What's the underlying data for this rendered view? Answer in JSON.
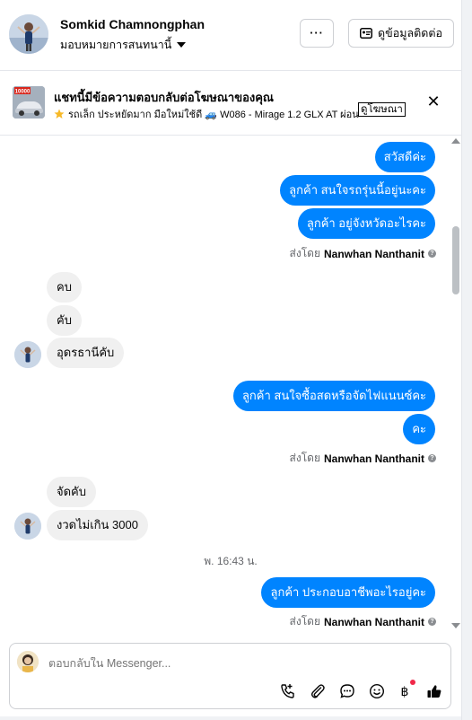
{
  "header": {
    "contact_name": "Somkid Chamnongphan",
    "assign_label": "มอบหมายการสนทนานี้",
    "more_button_label": "···",
    "contact_info_button_label": "ดูข้อมูลติดต่อ"
  },
  "ad_banner": {
    "title": "แชทนี้มีข้อความตอบกลับต่อโฆษณาของคุณ",
    "subtitle": "รถเล็ก ประหยัดมาก มือใหม่ใช้ดี 🚙 W086 - Mirage 1.2 GLX AT ผ่อน ...",
    "ad_link_label": "ดูโฆษณา",
    "thumbnail_price": "10000",
    "close_label": "✕"
  },
  "messages": {
    "m1": "สวัสดีค่ะ",
    "m2": "ลูกค้า สนใจรถรุ่นนี้อยู่นะคะ",
    "m3": "ลูกค้า อยู่จังหวัดอะไรคะ",
    "sent_by_1_prefix": "ส่งโดย",
    "sent_by_1_name": "Nanwhan Nanthanit",
    "m4": "คบ",
    "m5": "คับ",
    "m6": "อุดรธานีคับ",
    "m7": "ลูกค้า สนใจซื้อสดหรือจัดไฟแนนซ์คะ",
    "m8": "คะ",
    "sent_by_2_prefix": "ส่งโดย",
    "sent_by_2_name": "Nanwhan Nanthanit",
    "m9": "จัดคับ",
    "m10": "งวดไม่เกิน 3000",
    "timestamp": "พ. 16:43 น.",
    "m11": "ลูกค้า ประกอบอาชีพอะไรอยู่คะ",
    "sent_by_3_prefix": "ส่งโดย",
    "sent_by_3_name": "Nanwhan Nanthanit"
  },
  "composer": {
    "placeholder": "ตอบกลับใน Messenger..."
  },
  "toolbar_icons": [
    "call-icon",
    "attach-icon",
    "saved-reply-icon",
    "emoji-icon",
    "payment-icon",
    "like-icon"
  ],
  "colors": {
    "outgoing_bubble": "#0084ff",
    "incoming_bubble": "#f0f0f0",
    "notification_dot": "#f02849"
  }
}
